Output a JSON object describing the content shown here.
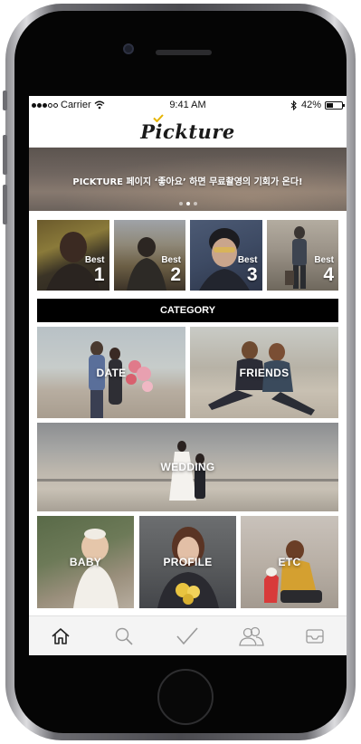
{
  "status_bar": {
    "carrier": "Carrier",
    "time": "9:41 AM",
    "battery": "42%",
    "battery_level": 0.42,
    "signal_bars_filled": 3,
    "signal_bars_total": 5
  },
  "header": {
    "logo_text": "Pickture"
  },
  "banner": {
    "text": "PICKTURE 페이지 ‘좋아요’ 하면 무료촬영의 기회가 온다!",
    "page_count": 3,
    "active_page": 2
  },
  "best": [
    {
      "label": "Best",
      "rank": "1"
    },
    {
      "label": "Best",
      "rank": "2"
    },
    {
      "label": "Best",
      "rank": "3"
    },
    {
      "label": "Best",
      "rank": "4"
    }
  ],
  "category_title": "CATEGORY",
  "categories": [
    {
      "label": "DATE"
    },
    {
      "label": "FRIENDS"
    },
    {
      "label": "WEDDING"
    },
    {
      "label": "BABY"
    },
    {
      "label": "PROFILE"
    },
    {
      "label": "ETC"
    }
  ],
  "tabbar": {
    "tabs": [
      {
        "icon": "home-icon",
        "active": true
      },
      {
        "icon": "search-icon",
        "active": false
      },
      {
        "icon": "check-icon",
        "active": false
      },
      {
        "icon": "people-icon",
        "active": false
      },
      {
        "icon": "inbox-icon",
        "active": false
      }
    ]
  },
  "colors": {
    "accent": "#e6b400",
    "category_bar": "#000000",
    "tab_active": "#222222",
    "tab_inactive": "#9a9a9a"
  }
}
